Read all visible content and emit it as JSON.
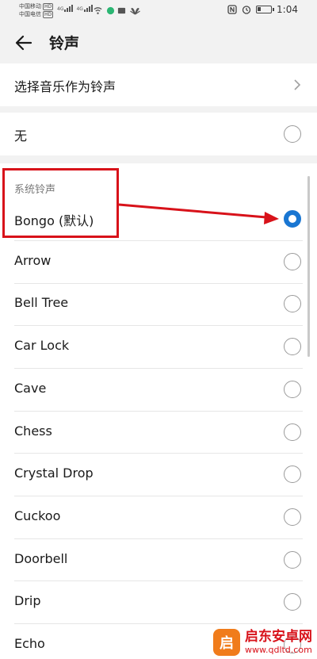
{
  "status_bar": {
    "carrier1": "中国移动",
    "carrier2": "中国电信",
    "hd": "HD",
    "net1": "4G",
    "net2": "4G",
    "time": "1:04"
  },
  "header": {
    "back_icon": "back-arrow-icon",
    "title": "铃声"
  },
  "music_row": {
    "label": "选择音乐作为铃声",
    "icon": "chevron-right-icon"
  },
  "none_row": {
    "label": "无",
    "selected": false
  },
  "system_section": {
    "title": "系统铃声",
    "items": [
      {
        "label": "Bongo (默认)",
        "selected": true
      },
      {
        "label": "Arrow",
        "selected": false
      },
      {
        "label": "Bell Tree",
        "selected": false
      },
      {
        "label": "Car Lock",
        "selected": false
      },
      {
        "label": "Cave",
        "selected": false
      },
      {
        "label": "Chess",
        "selected": false
      },
      {
        "label": "Crystal Drop",
        "selected": false
      },
      {
        "label": "Cuckoo",
        "selected": false
      },
      {
        "label": "Doorbell",
        "selected": false
      },
      {
        "label": "Drip",
        "selected": false
      },
      {
        "label": "Echo",
        "selected": false
      }
    ]
  },
  "colors": {
    "accent": "#1976d2",
    "annotation": "#d8121a"
  },
  "watermark": {
    "logo_glyph": "启",
    "name": "启东安卓网",
    "url": "www.qdltd.com"
  }
}
